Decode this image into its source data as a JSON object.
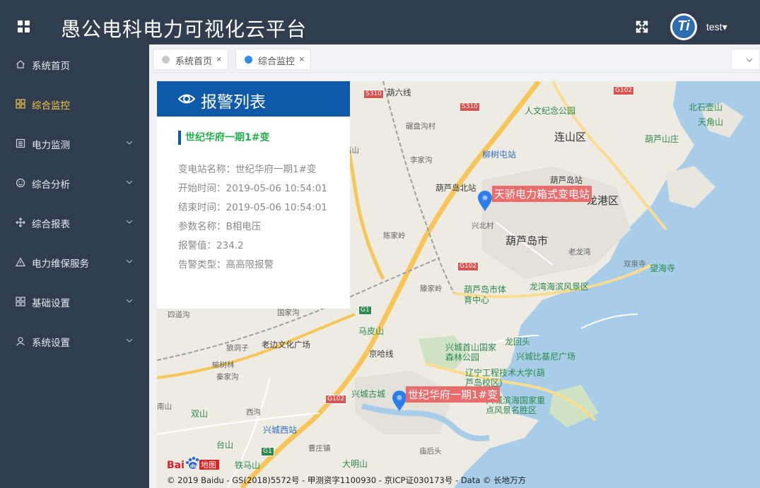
{
  "header": {
    "title": "愚公电科电力可视化云平台",
    "username": "test▾",
    "avatar_text": "Ti"
  },
  "sidebar": {
    "items": [
      {
        "label": "系统首页",
        "icon": "home-icon",
        "has_arrow": false,
        "active": false
      },
      {
        "label": "综合监控",
        "icon": "grid-icon",
        "has_arrow": false,
        "active": true
      },
      {
        "label": "电力监测",
        "icon": "list-icon",
        "has_arrow": true,
        "active": false
      },
      {
        "label": "综合分析",
        "icon": "smile-icon",
        "has_arrow": true,
        "active": false
      },
      {
        "label": "综合报表",
        "icon": "move-icon",
        "has_arrow": true,
        "active": false
      },
      {
        "label": "电力维保服务",
        "icon": "warning-icon",
        "has_arrow": true,
        "active": false
      },
      {
        "label": "基础设置",
        "icon": "grid-icon",
        "has_arrow": true,
        "active": false
      },
      {
        "label": "系统设置",
        "icon": "user-icon",
        "has_arrow": true,
        "active": false
      }
    ]
  },
  "tabs": [
    {
      "label": "系统首页",
      "close": "×",
      "dot_color": "#c8c8c8"
    },
    {
      "label": "综合监控",
      "close": "×",
      "dot_color": "#2d8cf0"
    }
  ],
  "alarm": {
    "title": "报警列表",
    "station": "世纪华府一期1#变",
    "fields": [
      "变电站名称：世纪华府一期1#变",
      "开始时间：2019-05-06 10:54:01",
      "结束时间：2019-05-06 10:54:01",
      "参数名称：B相电压",
      "报警值：234.2",
      "告警类型：高高限报警"
    ]
  },
  "map": {
    "markers": [
      {
        "label": "天骄电力箱式变电站"
      },
      {
        "label": "世纪华府一期1#变"
      }
    ],
    "places": [
      "葫六线",
      "人文纪念公园",
      "碾盘沟村",
      "连山区",
      "北石壶山",
      "天角山",
      "葫芦山庄",
      "李家沟",
      "柳树屯站",
      "葫芦岛站",
      "葫芦岛北站",
      "龙港区",
      "陈家岭",
      "兴北村",
      "葫芦岛市",
      "老龙湾",
      "双泉寺",
      "望海寺",
      "滕家岭",
      "葫芦岛市体育中心",
      "龙湾海滨风景区",
      "四道沟",
      "国家沟",
      "马皮山",
      "老边文化广场",
      "狼洞子",
      "京哈线",
      "兴城首山国家森林公园",
      "龙回头",
      "兴城比基尼广场",
      "榆树林",
      "秦家沟",
      "辽宁工程技术大学(葫芦岛校区)",
      "兴城古城",
      "南山",
      "双山",
      "西沟",
      "兴城西站",
      "兴城滨海国家重点风景名胜区",
      "台山",
      "曹庄镇",
      "庙后头",
      "铁马山",
      "大明山",
      "石山"
    ],
    "roads": [
      "S310",
      "S310",
      "G102",
      "G102",
      "G1",
      "G102",
      "G1"
    ],
    "copyright": "© 2019 Baidu - GS(2018)5572号 - 甲测资字1100930 - 京ICP证030173号 - Data © 长地万方",
    "logo_text": "Bai地图"
  },
  "colors": {
    "header_bg": "#2f3d4f",
    "active_menu": "#f4c54a",
    "alarm_header": "#0e5aa8",
    "station_green": "#22b04a",
    "marker_label": "#e96d6d",
    "sea": "#a8cde8"
  }
}
